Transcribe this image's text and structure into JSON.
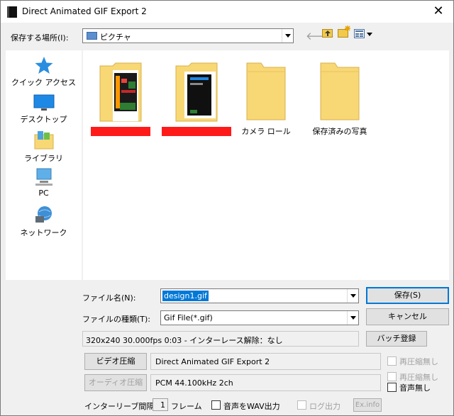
{
  "window": {
    "title": "Direct Animated GIF Export 2",
    "close_glyph": "✕"
  },
  "location": {
    "label": "保存する場所(I):",
    "value": "ピクチャ"
  },
  "toolbar": {
    "icons": [
      "back-icon",
      "up-folder-icon",
      "new-folder-icon",
      "view-menu-icon"
    ]
  },
  "places": [
    {
      "label": "クイック アクセス",
      "icon": "star-icon"
    },
    {
      "label": "デスクトップ",
      "icon": "desktop-icon"
    },
    {
      "label": "ライブラリ",
      "icon": "library-icon"
    },
    {
      "label": "PC",
      "icon": "pc-icon"
    },
    {
      "label": "ネットワーク",
      "icon": "network-icon"
    }
  ],
  "files": [
    {
      "label": "",
      "redacted": true,
      "thumb": "folder-green-thumb"
    },
    {
      "label": "",
      "redacted": true,
      "thumb": "folder-dark-thumb"
    },
    {
      "label": "カメラ ロール",
      "redacted": false,
      "thumb": "folder-plain"
    },
    {
      "label": "保存済みの写真",
      "redacted": false,
      "thumb": "folder-plain"
    }
  ],
  "filename": {
    "label": "ファイル名(N):",
    "value": "design1.gif"
  },
  "filetype": {
    "label": "ファイルの種類(T):",
    "value": "Gif File(*.gif)"
  },
  "buttons": {
    "save": "保存(S)",
    "cancel": "キャンセル",
    "batch": "バッチ登録",
    "video_compress": "ビデオ圧縮",
    "audio_compress": "オーディオ圧縮",
    "exinfo": "Ex.info"
  },
  "info": {
    "video_info": "320x240  30.000fps  0:03  -  インターレース解除：なし",
    "video_codec": "Direct Animated GIF Export 2",
    "audio_codec": "PCM 44.100kHz 2ch"
  },
  "options": {
    "recompress_video": "再圧縮無し",
    "recompress_audio": "再圧縮無し",
    "no_audio": "音声無し",
    "interleave_label": "インターリーブ間隔：",
    "interleave_value": "1",
    "interleave_unit": "フレーム",
    "audio_wav": "音声をWAV出力",
    "log_output": "ログ出力"
  },
  "colors": {
    "accent": "#0078d7",
    "folder": "#f8d775",
    "redaction": "#ff1a1a"
  }
}
